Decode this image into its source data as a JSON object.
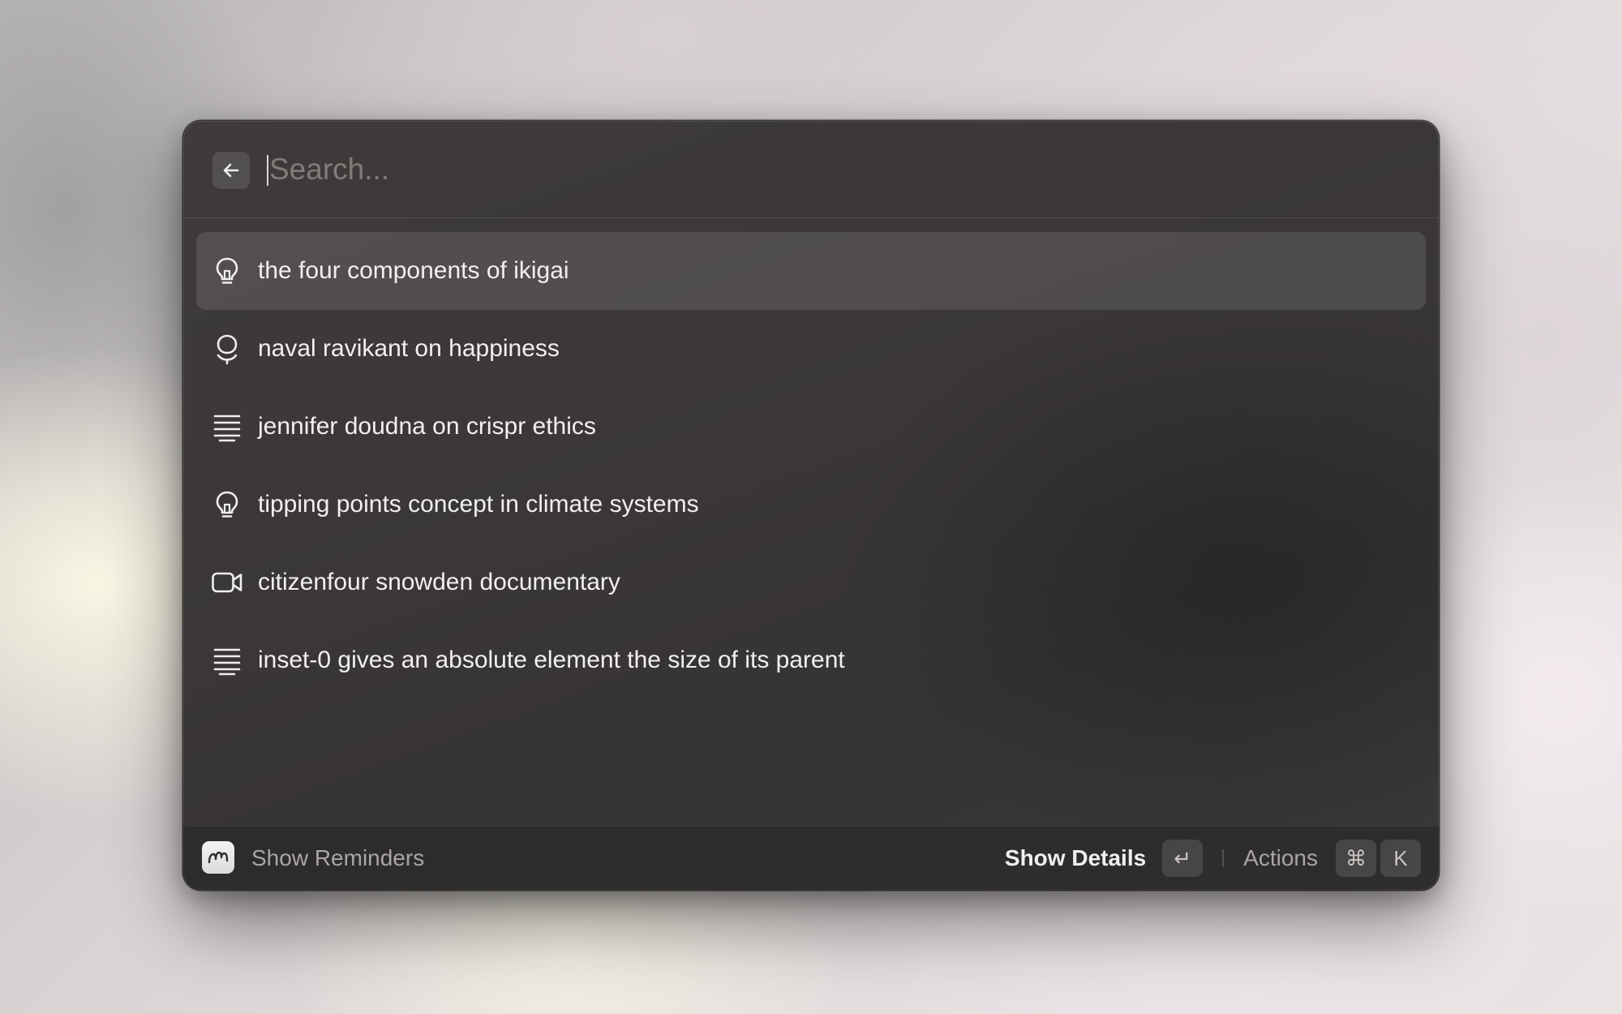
{
  "search": {
    "placeholder": "Search...",
    "value": ""
  },
  "header": {
    "back_icon": "arrow-left-icon"
  },
  "results": [
    {
      "label": "the four components of ikigai",
      "icon": "lightbulb-icon",
      "selected": true
    },
    {
      "label": "naval ravikant on happiness",
      "icon": "podcast-icon",
      "selected": false
    },
    {
      "label": "jennifer doudna on crispr ethics",
      "icon": "text-lines-icon",
      "selected": false
    },
    {
      "label": "tipping points concept in climate systems",
      "icon": "lightbulb-icon",
      "selected": false
    },
    {
      "label": "citizenfour snowden documentary",
      "icon": "video-icon",
      "selected": false
    },
    {
      "label": "inset-0 gives an absolute element the size of its parent",
      "icon": "text-lines-icon",
      "selected": false
    }
  ],
  "footer": {
    "app_icon": "app-logo-icon",
    "left_label": "Show Reminders",
    "primary_action_label": "Show Details",
    "primary_action_key": "↵",
    "actions_label": "Actions",
    "actions_keys": [
      "⌘",
      "K"
    ]
  },
  "colors": {
    "window_bg": "#3a3736",
    "selected_row_bg": "rgba(255,255,255,0.11)",
    "text_primary": "#f2f0ef",
    "text_secondary": "#a9a6a4",
    "placeholder": "#7f7c7a"
  }
}
